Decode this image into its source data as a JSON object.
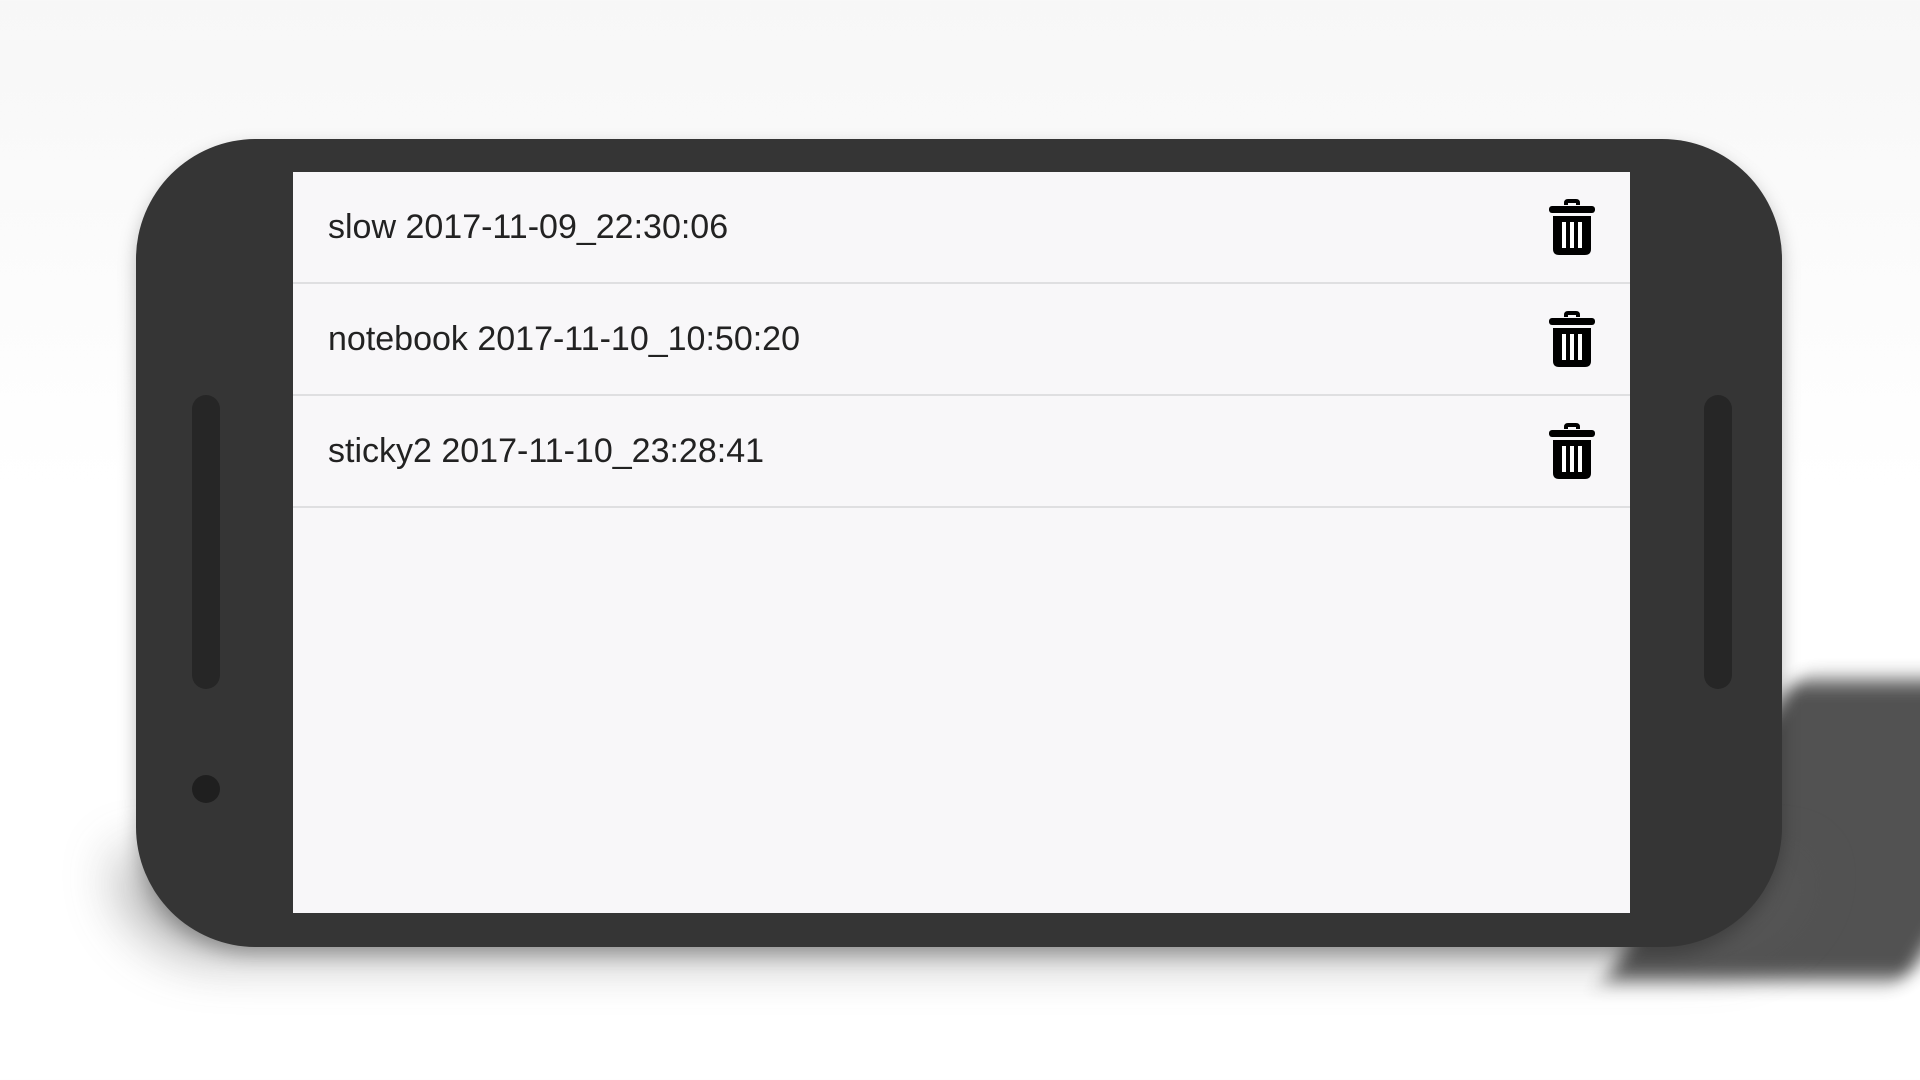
{
  "colors": {
    "device_body": "#353535",
    "screen_background": "#f8f7f9",
    "divider": "#dfdfe1",
    "text": "#222222",
    "icon": "#000000"
  },
  "sessions": {
    "items": [
      {
        "label": "slow 2017-11-09_22:30:06",
        "action_icon": "trash-icon"
      },
      {
        "label": "notebook 2017-11-10_10:50:20",
        "action_icon": "trash-icon"
      },
      {
        "label": "sticky2 2017-11-10_23:28:41",
        "action_icon": "trash-icon"
      }
    ]
  }
}
